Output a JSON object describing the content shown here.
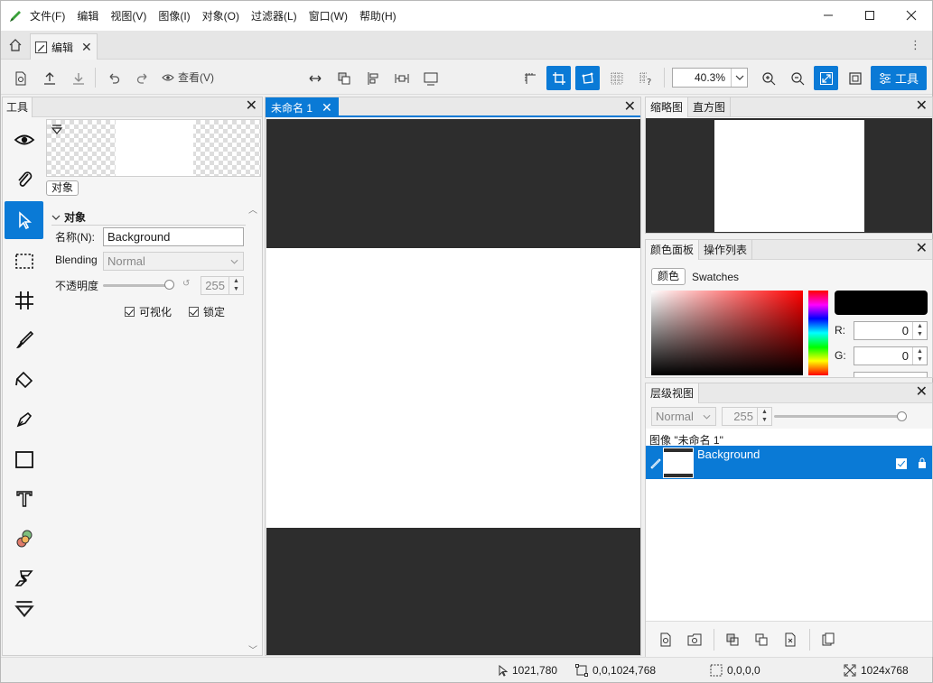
{
  "app": {
    "menu": [
      "文件(F)",
      "编辑",
      "视图(V)",
      "图像(I)",
      "对象(O)",
      "过滤器(L)",
      "窗口(W)",
      "帮助(H)"
    ],
    "window_controls": [
      "minimize",
      "maximize",
      "close"
    ]
  },
  "tabs": {
    "home_icon": "home-icon",
    "doc_tab_label": "编辑"
  },
  "toolbar": {
    "view_label": "查看(V)",
    "zoom_value": "40.3%",
    "tools_label": "工具",
    "accent": "#0a7ad6"
  },
  "left_panel": {
    "title": "工具",
    "object_chip": "对象",
    "section_title": "对象",
    "name_label": "名称(N):",
    "name_value": "Background",
    "blending_label": "Blending",
    "blending_value": "Normal",
    "opacity_label": "不透明度",
    "opacity_value": "255",
    "visible_label": "可视化",
    "locked_label": "锁定",
    "tools": [
      "eye-icon",
      "paperclip-icon",
      "pointer-icon",
      "marquee-icon",
      "crop-icon",
      "brush-icon",
      "fill-icon",
      "pen-icon",
      "rectangle-icon",
      "text-icon",
      "color-balls-icon",
      "script-icon",
      "more-icon"
    ],
    "selected_tool": "pointer-icon"
  },
  "canvas": {
    "tab_label": "未命名 1"
  },
  "navigator": {
    "tabs": [
      "缩略图",
      "直方图"
    ]
  },
  "color_panel": {
    "tabs": [
      "颜色面板",
      "操作列表"
    ],
    "mode_button": "颜色",
    "swatches_label": "Swatches",
    "current_color": "#000000",
    "r_label": "R:",
    "r_value": "0",
    "g_label": "G:",
    "g_value": "0"
  },
  "layers": {
    "title": "层级视图",
    "blend_mode": "Normal",
    "opacity": "255",
    "image_label": "图像 \"未命名 1\"",
    "layer_name": "Background"
  },
  "status": {
    "cursor": "1021,780",
    "selection": "0,0,1024,768",
    "size_box": "0,0,0,0",
    "image_size": "1024x768"
  }
}
